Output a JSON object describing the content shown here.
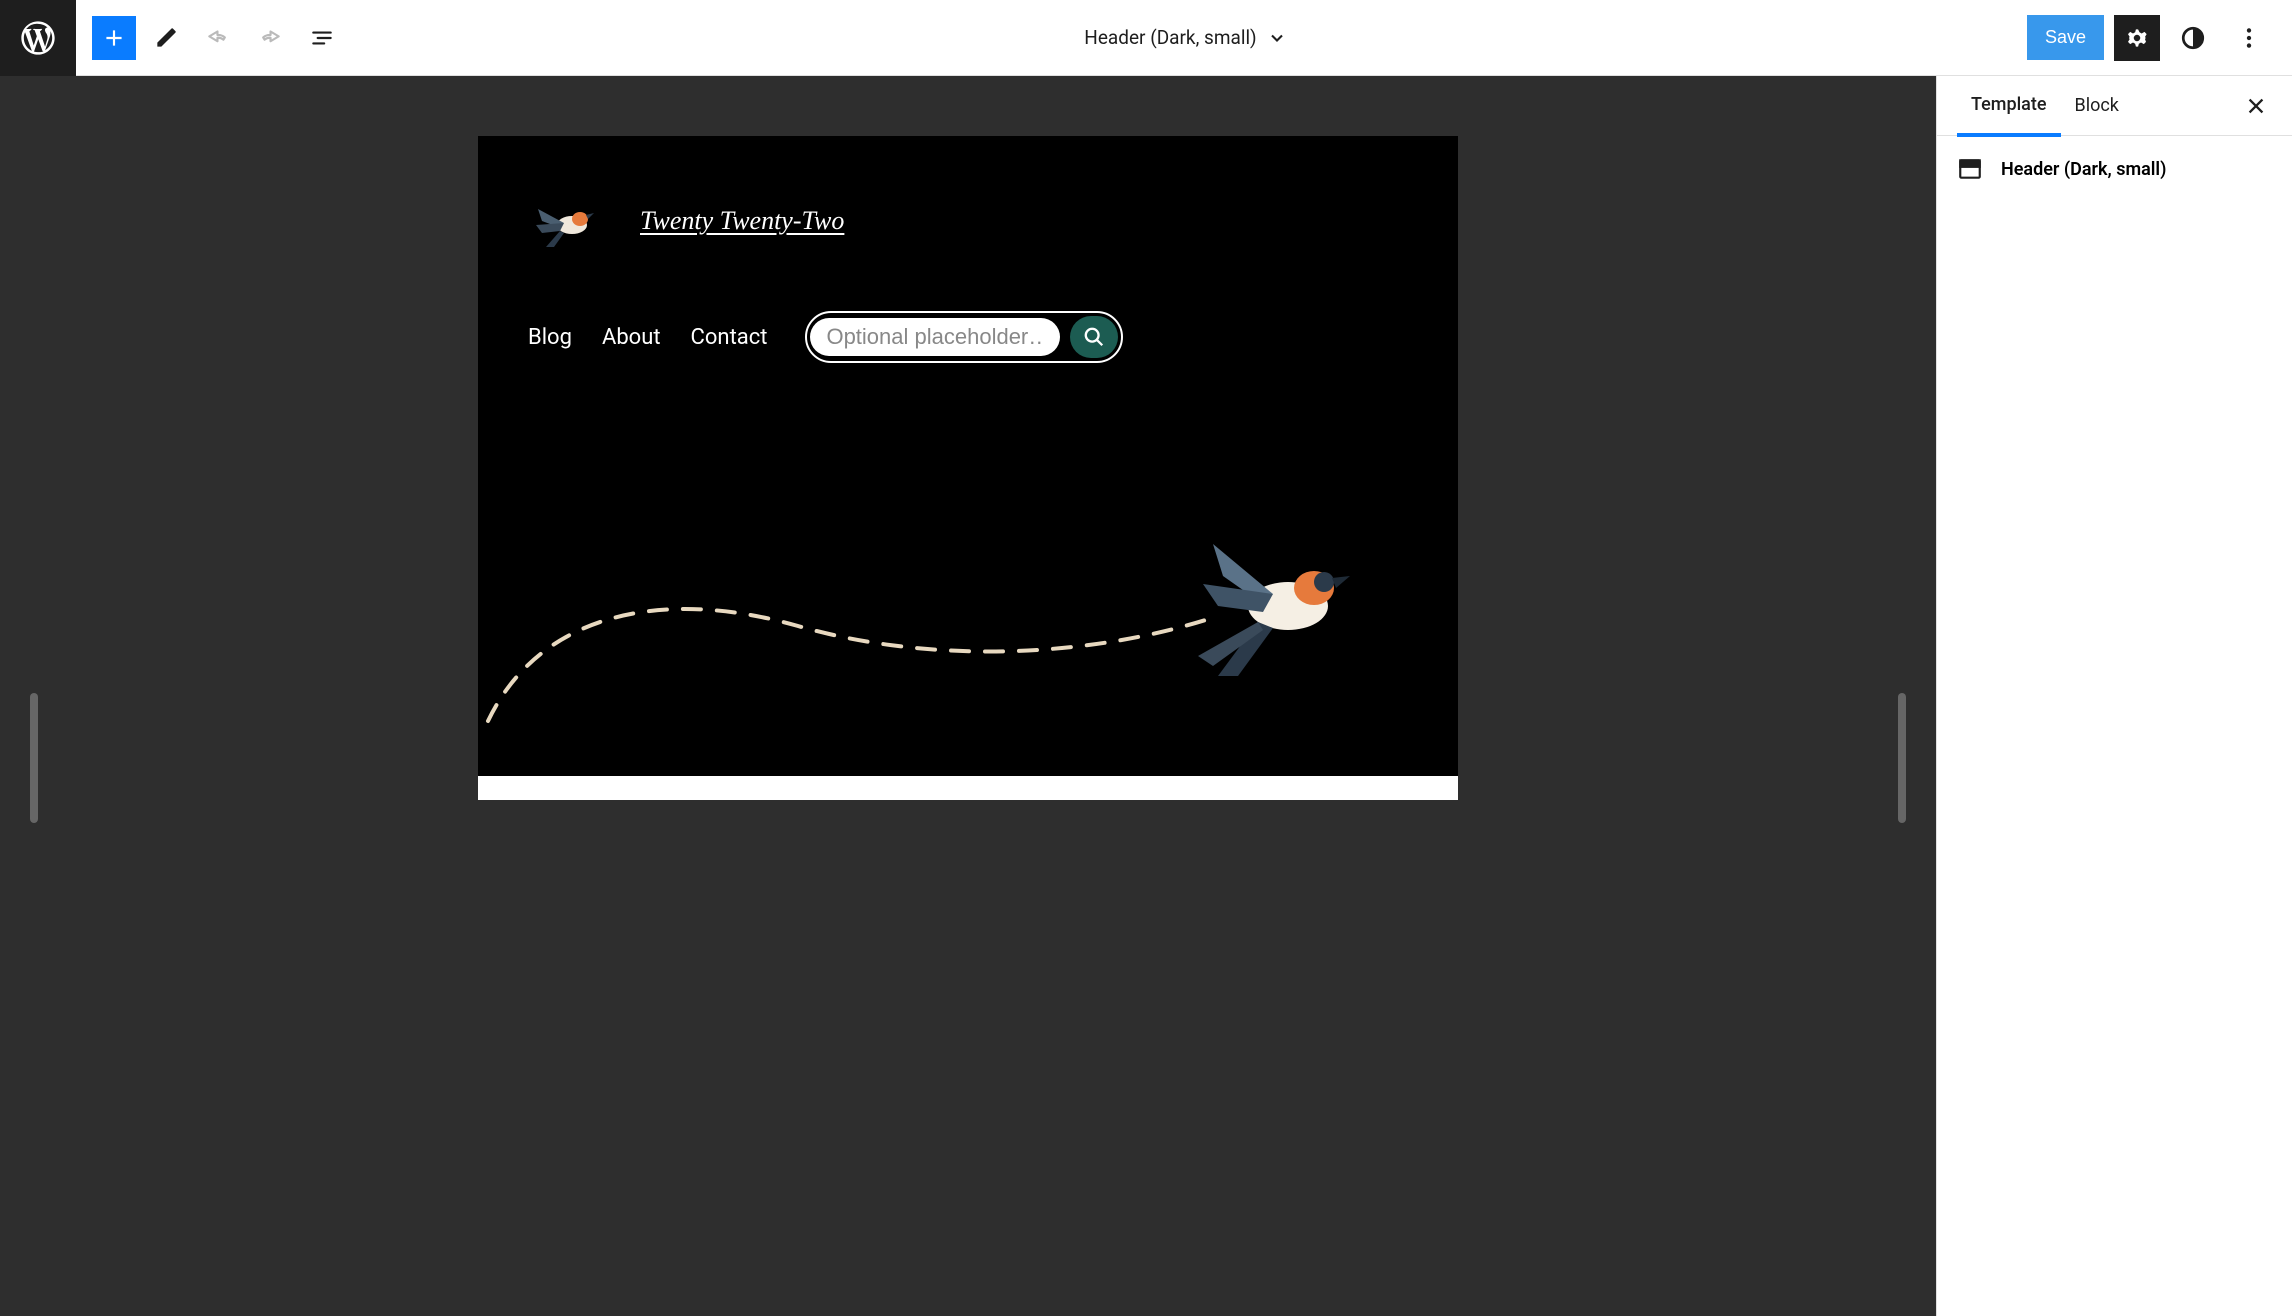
{
  "topbar": {
    "document_title": "Header (Dark, small)",
    "save_label": "Save"
  },
  "sidebar": {
    "tabs": {
      "template": "Template",
      "block": "Block"
    },
    "template_name": "Header (Dark, small)"
  },
  "preview": {
    "site_title": "Twenty Twenty-Two",
    "nav": [
      "Blog",
      "About",
      "Contact"
    ],
    "search_placeholder": "Optional placeholder…"
  },
  "colors": {
    "accent": "#0a7cff",
    "toolbar_dark": "#1e1e1e",
    "canvas_bg": "#2e2e2e",
    "search_btn": "#1c5c52"
  }
}
